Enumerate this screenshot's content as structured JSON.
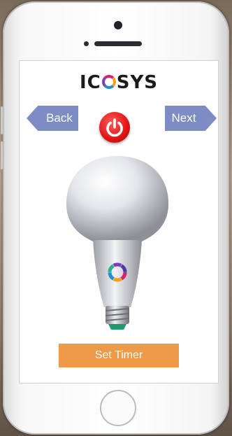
{
  "app": {
    "logo_text_before": "IC",
    "logo_text_after": "SYS",
    "logo_o_icon": "multicolor-aperture-icon"
  },
  "nav": {
    "back_label": "Back",
    "next_label": "Next",
    "accent_color": "#7d8cc4"
  },
  "controls": {
    "power_icon": "power-icon",
    "power_color": "#e01414",
    "timer_label": "Set Timer",
    "timer_color": "#ef9a49"
  },
  "device": {
    "image_icon": "light-bulb-icon",
    "badge_icon": "aperture-logo-icon"
  }
}
